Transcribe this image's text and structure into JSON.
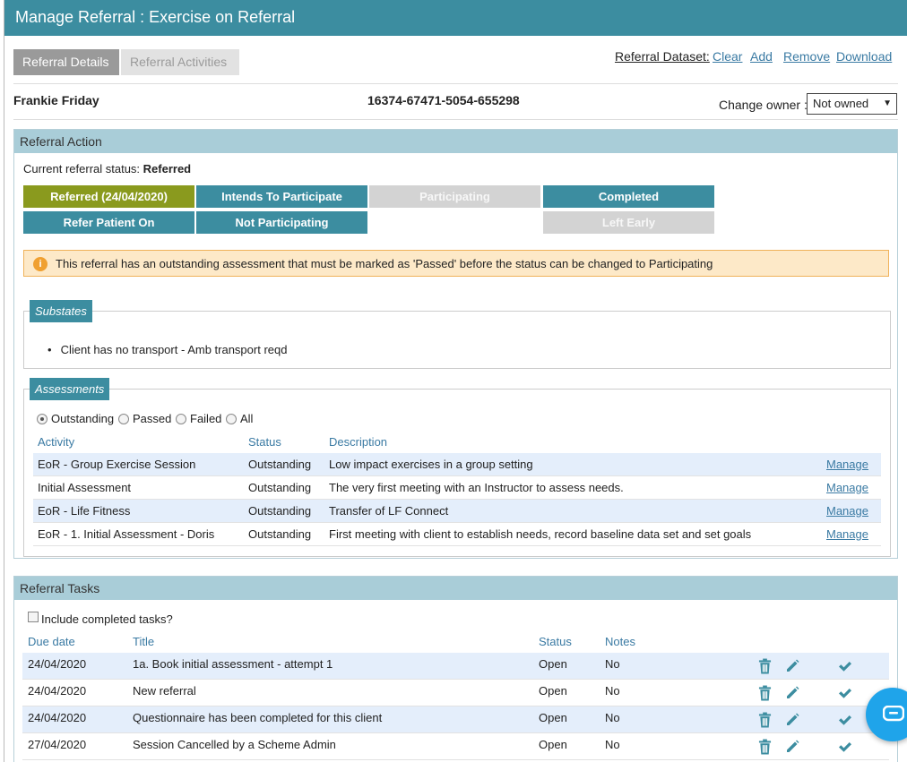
{
  "window": {
    "title": "Manage Referral : Exercise on Referral"
  },
  "tabs": [
    {
      "label": "Referral Details",
      "active": true
    },
    {
      "label": "Referral Activities",
      "active": false
    }
  ],
  "dataset": {
    "label": "Referral Dataset:",
    "clear": "Clear",
    "add": "Add",
    "remove": "Remove",
    "download": "Download"
  },
  "client": {
    "name": "Frankie Friday",
    "reference": "16374-67471-5054-655298",
    "owner_label": "Change owner :",
    "owner_value": "Not owned"
  },
  "referral_action": {
    "heading": "Referral Action",
    "status_prefix": "Current referral status: ",
    "status_value": "Referred",
    "buttons": [
      {
        "label": "Referred (24/04/2020)",
        "state": "current"
      },
      {
        "label": "Intends To Participate",
        "state": "enabled"
      },
      {
        "label": "Participating",
        "state": "disabled"
      },
      {
        "label": "Completed",
        "state": "enabled"
      },
      {
        "label": "Refer Patient On",
        "state": "enabled"
      },
      {
        "label": "Not Participating",
        "state": "enabled"
      },
      {
        "label": "Left Early",
        "state": "disabled"
      }
    ],
    "warning": "This referral has an outstanding assessment that must be marked as 'Passed' before the status can be changed to Participating"
  },
  "substates": {
    "legend": "Substates",
    "items": [
      "Client has no transport - Amb transport reqd"
    ]
  },
  "assessments": {
    "legend": "Assessments",
    "filters": [
      {
        "label": "Outstanding",
        "checked": true
      },
      {
        "label": "Passed",
        "checked": false
      },
      {
        "label": "Failed",
        "checked": false
      },
      {
        "label": "All",
        "checked": false
      }
    ],
    "columns": [
      "Activity",
      "Status",
      "Description"
    ],
    "rows": [
      {
        "activity": "EoR - Group Exercise Session",
        "status": "Outstanding",
        "description": "Low impact exercises in a group setting",
        "action": "Manage"
      },
      {
        "activity": "Initial Assessment",
        "status": "Outstanding",
        "description": "The very first meeting with an Instructor to assess needs.",
        "action": "Manage"
      },
      {
        "activity": "EoR - Life Fitness",
        "status": "Outstanding",
        "description": "Transfer of LF Connect",
        "action": "Manage"
      },
      {
        "activity": "EoR - 1. Initial Assessment - Doris",
        "status": "Outstanding",
        "description": "First meeting with client to establish needs, record baseline data set and set goals",
        "action": "Manage"
      }
    ]
  },
  "tasks": {
    "heading": "Referral Tasks",
    "include_completed_label": "Include completed tasks?",
    "columns": [
      "Due date",
      "Title",
      "Status",
      "Notes"
    ],
    "rows": [
      {
        "due": "24/04/2020",
        "title": "1a. Book initial assessment - attempt 1",
        "status": "Open",
        "notes": "No"
      },
      {
        "due": "24/04/2020",
        "title": "New referral",
        "status": "Open",
        "notes": "No"
      },
      {
        "due": "24/04/2020",
        "title": "Questionnaire has been completed for this client",
        "status": "Open",
        "notes": "No"
      },
      {
        "due": "27/04/2020",
        "title": "Session Cancelled by a Scheme Admin",
        "status": "Open",
        "notes": "No"
      }
    ],
    "icons": [
      "trash-icon",
      "pencil-icon",
      "checkmark-icon"
    ]
  },
  "colors": {
    "header": "#3c8da0",
    "current_status": "#8a9a1e",
    "disabled_status": "#d3d3d3",
    "warning_bg": "#fde9c8",
    "warning_border": "#f0b25a",
    "panel_head": "#a9cdd8",
    "row_alt": "#e4eefb",
    "link": "#3a7aa3",
    "chat": "#1fa4ea"
  }
}
